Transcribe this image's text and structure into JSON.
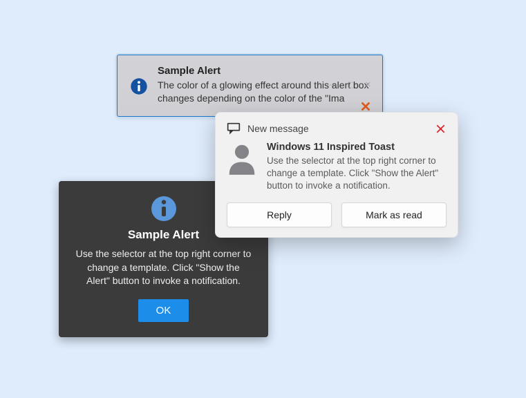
{
  "alert1": {
    "title": "Sample Alert",
    "body": "The color of a glowing effect around this alert box changes depending on the color of the \"Ima"
  },
  "alert2": {
    "header": "New message",
    "title": "Windows 11 Inspired Toast",
    "body": "Use the selector at the top right corner to change a template. Click \"Show the Alert\" button to invoke a notification.",
    "reply_label": "Reply",
    "mark_read_label": "Mark as read"
  },
  "alert3": {
    "title": "Sample Alert",
    "body": "Use the selector at the top right corner to change a template. Click \"Show the Alert\" button to invoke a notification.",
    "ok_label": "OK"
  },
  "colors": {
    "background": "#dfecfc",
    "alert1_border": "#1f72c2",
    "alert2_bg": "#f1f1f2",
    "alert3_bg": "#3b3b3b",
    "primary_button": "#1c8de8",
    "close_red": "#d7262b",
    "close_orange": "#e25a1b"
  }
}
